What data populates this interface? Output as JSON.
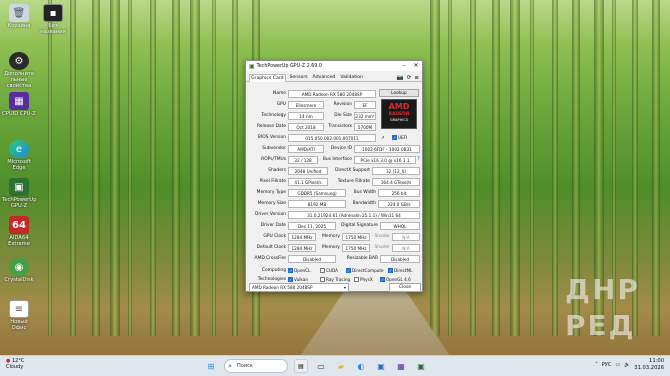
{
  "desktop": {
    "icons": [
      {
        "label": "Корзина",
        "icon": "recycle-bin-icon"
      },
      {
        "label": "Дополните\nльные\nсвойства",
        "icon": "settings-icon"
      },
      {
        "label": "CPUID CPU-Z",
        "icon": "cpuz-icon"
      },
      {
        "label": "Microsoft\nEdge",
        "icon": "edge-icon"
      },
      {
        "label": "TechPowerUp\nGPU-Z",
        "icon": "gpuz-icon"
      },
      {
        "label": "AIDA64\nExtreme",
        "icon": "aida64-icon"
      },
      {
        "label": "CrystalDisk",
        "icon": "crystaldisk-icon"
      },
      {
        "label": "Новый\nОфис",
        "icon": "document-icon"
      }
    ],
    "top_icon_label": "Без\nназвания"
  },
  "gpuz": {
    "title": "TechPowerUp GPU-Z 2.69.0",
    "tabs": [
      "Graphics Card",
      "Sensors",
      "Advanced",
      "Validation"
    ],
    "active_tab": "Graphics Card",
    "name_label": "Name",
    "name_value": "AMD Radeon RX 580 2048SP",
    "lookup_label": "Lookup",
    "gpu_label": "GPU",
    "gpu_value": "Ellesmere",
    "revision_label": "Revision",
    "revision_value": "EF",
    "technology_label": "Technology",
    "technology_value": "14 nm",
    "diesize_label": "Die Size",
    "diesize_value": "232 mm²",
    "release_label": "Release Date",
    "release_value": "Oct 2018",
    "transistors_label": "Transistors",
    "transistors_value": "5700M",
    "bios_label": "BIOS Version",
    "bios_value": "015.050.002.001.007011",
    "uefi_label": "UEFI",
    "subvendor_label": "Subvendor",
    "subvendor_value": "AMD/ATI",
    "deviceid_label": "Device ID",
    "deviceid_value": "1002 6FDF - 1002 0B31",
    "rops_label": "ROPs/TMUs",
    "rops_value": "32 / 128",
    "businterface_label": "Bus Interface",
    "businterface_value": "PCIe x16 3.0 @ x16 1.1",
    "shaders_label": "Shaders",
    "shaders_value": "2048 Unified",
    "directx_label": "DirectX Support",
    "directx_value": "12 (12_0)",
    "pixelfill_label": "Pixel Fillrate",
    "pixelfill_value": "41.1 GPixel/s",
    "texturefill_label": "Texture Fillrate",
    "texturefill_value": "164.4 GTexel/s",
    "memtype_label": "Memory Type",
    "memtype_value": "GDDR5 (Samsung)",
    "buswidth_label": "Bus Width",
    "buswidth_value": "256 bit",
    "memsize_label": "Memory Size",
    "memsize_value": "8192 MB",
    "bandwidth_label": "Bandwidth",
    "bandwidth_value": "224.0 GB/s",
    "driverver_label": "Driver Version",
    "driverver_value": "31.0.21924.61 (Adrenalin 25.1.1) / Win11 64",
    "driverdate_label": "Driver Date",
    "driverdate_value": "Dec 11, 2025",
    "digsig_label": "Digital Signature",
    "digsig_value": "WHQL",
    "gpuclock_label": "GPU Clock",
    "gpuclock_value": "1284 MHz",
    "memory_label": "Memory",
    "gpuclock_mem_value": "1750 MHz",
    "shader_label": "Shader",
    "shader_value": "N/A",
    "defclock_label": "Default Clock",
    "defclock_value": "1284 MHz",
    "defclock_mem_value": "1750 MHz",
    "defshader_value": "N/A",
    "crossfire_label": "AMD CrossFire",
    "crossfire_value": "Disabled",
    "rebar_label": "Resizable BAR",
    "rebar_value": "Disabled",
    "computing_label": "Computing",
    "computing": [
      {
        "label": "OpenCL",
        "checked": true
      },
      {
        "label": "CUDA",
        "checked": false
      },
      {
        "label": "DirectCompute",
        "checked": true
      },
      {
        "label": "DirectML",
        "checked": true
      }
    ],
    "technologies_label": "Technologies",
    "technologies": [
      {
        "label": "Vulkan",
        "checked": true
      },
      {
        "label": "Ray Tracing",
        "checked": false
      },
      {
        "label": "PhysX",
        "checked": false
      },
      {
        "label": "OpenGL 4.6",
        "checked": true
      }
    ],
    "selected_card": "AMD Radeon RX 580 2048SP",
    "close_label": "Close",
    "logo_brand": "AMD",
    "logo_sub": "RADEON",
    "logo_sub2": "GRAPHICS"
  },
  "taskbar": {
    "weather_temp": "12°C",
    "weather_desc": "Cloudy",
    "search_placeholder": "Поиск",
    "lang": "РУС",
    "time": "11:00",
    "date": "31.03.2026"
  },
  "watermark": {
    "line1": "ДНР",
    "line2": "РЕД"
  },
  "colors": {
    "accent": "#1f6fd1",
    "amd_red": "#e0262c",
    "taskbar": "#dfe6ee"
  }
}
